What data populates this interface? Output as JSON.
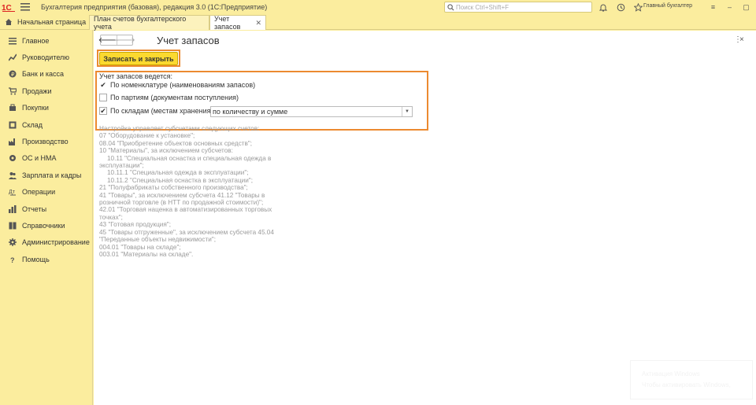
{
  "topbar": {
    "logo_text": "1С",
    "app_title": "Бухгалтерия предприятия (базовая), редакция 3.0  (1С:Предприятие)",
    "search_placeholder": "Поиск Ctrl+Shift+F",
    "user_name": "Главный бухгалтер",
    "icons": [
      "bell-icon",
      "history-icon",
      "star-icon"
    ],
    "window_buttons": [
      "≡",
      "–",
      "▢",
      "✕"
    ]
  },
  "tabs": {
    "home_label": "Начальная страница",
    "items": [
      {
        "label": "План счетов бухгалтерского учета"
      },
      {
        "label": "Учет запасов"
      }
    ]
  },
  "sidebar": {
    "items": [
      {
        "label": "Главное",
        "icon": "menu-icon"
      },
      {
        "label": "Руководителю",
        "icon": "chart-icon"
      },
      {
        "label": "Банк и касса",
        "icon": "coin-icon"
      },
      {
        "label": "Продажи",
        "icon": "cart-icon"
      },
      {
        "label": "Покупки",
        "icon": "basket-icon"
      },
      {
        "label": "Склад",
        "icon": "warehouse-icon"
      },
      {
        "label": "Производство",
        "icon": "factory-icon"
      },
      {
        "label": "ОС и НМА",
        "icon": "asset-icon"
      },
      {
        "label": "Зарплата и кадры",
        "icon": "people-icon"
      },
      {
        "label": "Операции",
        "icon": "operations-icon"
      },
      {
        "label": "Отчеты",
        "icon": "report-icon"
      },
      {
        "label": "Справочники",
        "icon": "book-icon"
      },
      {
        "label": "Администрирование",
        "icon": "gear-icon"
      },
      {
        "label": "Помощь",
        "icon": "help-icon"
      }
    ]
  },
  "form": {
    "title": "Учет запасов",
    "more_label": "⋮",
    "close_label": "×",
    "save_close_label": "Записать и закрыть",
    "group_title": "Учет запасов ведется:",
    "option_nomenclature": "По номенклатуре (наименованиям запасов)",
    "option_batches": "По партиям (документам поступления)",
    "option_batches_checked": false,
    "option_warehouses": "По складам (местам хранения):",
    "option_warehouses_checked": true,
    "warehouse_mode_value": "по количеству и сумме"
  },
  "info": {
    "lines": [
      {
        "text": "Настройка управляет субсчетами следующих счетов:",
        "indent": false
      },
      {
        "text": "07 \"Оборудование к установке\";",
        "indent": false
      },
      {
        "text": "08.04 \"Приобретение объектов основных средств\";",
        "indent": false
      },
      {
        "text": "10 \"Материалы\", за исключением субсчетов:",
        "indent": false
      },
      {
        "text": "10.11 \"Специальная оснастка и специальная одежда в",
        "indent": true
      },
      {
        "text": "эксплуатации\";",
        "indent": false
      },
      {
        "text": "10.11.1 \"Специальная одежда в эксплуатации\";",
        "indent": true
      },
      {
        "text": "10.11.2 \"Специальная оснастка в эксплуатации\";",
        "indent": true
      },
      {
        "text": "21 \"Полуфабрикаты собственного производства\";",
        "indent": false
      },
      {
        "text": "41 \"Товары\", за исключением субсчета 41.12 \"Товары в",
        "indent": false
      },
      {
        "text": "розничной торговле (в НТТ по продажной стоимости)\";",
        "indent": false
      },
      {
        "text": "42.01 \"Торговая наценка в автоматизированных торговых",
        "indent": false
      },
      {
        "text": "точках\";",
        "indent": false
      },
      {
        "text": "43 \"Готовая продукция\";",
        "indent": false
      },
      {
        "text": "45 \"Товары отгруженные\", за исключением субсчета 45.04",
        "indent": false
      },
      {
        "text": "\"Переданные объекты недвижимости\";",
        "indent": false
      },
      {
        "text": "004.01 \"Товары на складе\";",
        "indent": false
      },
      {
        "text": "003.01 \"Материалы на складе\".",
        "indent": false
      }
    ]
  },
  "toast": {
    "line1": "Активация Windows",
    "line2": "Чтобы активировать Windows,"
  },
  "colors": {
    "panel_bg": "#fbed9e",
    "accent_button": "#fbd930",
    "highlight_frame": "#ec8a30"
  }
}
